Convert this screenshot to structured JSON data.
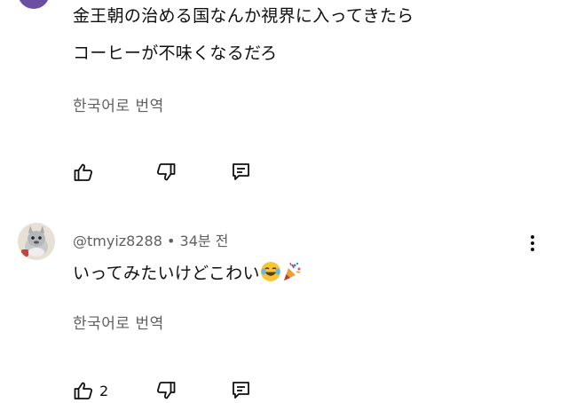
{
  "comment1": {
    "line1": "金王朝の治める国なんか視界に入ってきたら",
    "line2": "コーヒーが不味くなるだろ",
    "translate_label": "한국어로 번역"
  },
  "comment2": {
    "author": "@tmyiz8288",
    "separator": "•",
    "time": "34분 전",
    "text": "いってみたいけどこわい",
    "emoji_1": "😂",
    "emoji_2": "🎉",
    "translate_label": "한국어로 번역",
    "like_count": "2"
  },
  "icons": {
    "like": "thumbs-up-icon",
    "dislike": "thumbs-down-icon",
    "reply": "reply-icon",
    "more": "more-vert-icon"
  },
  "colors": {
    "text": "#0f0f0f",
    "secondary": "#606060",
    "avatar_top": "#6a4fa3"
  }
}
